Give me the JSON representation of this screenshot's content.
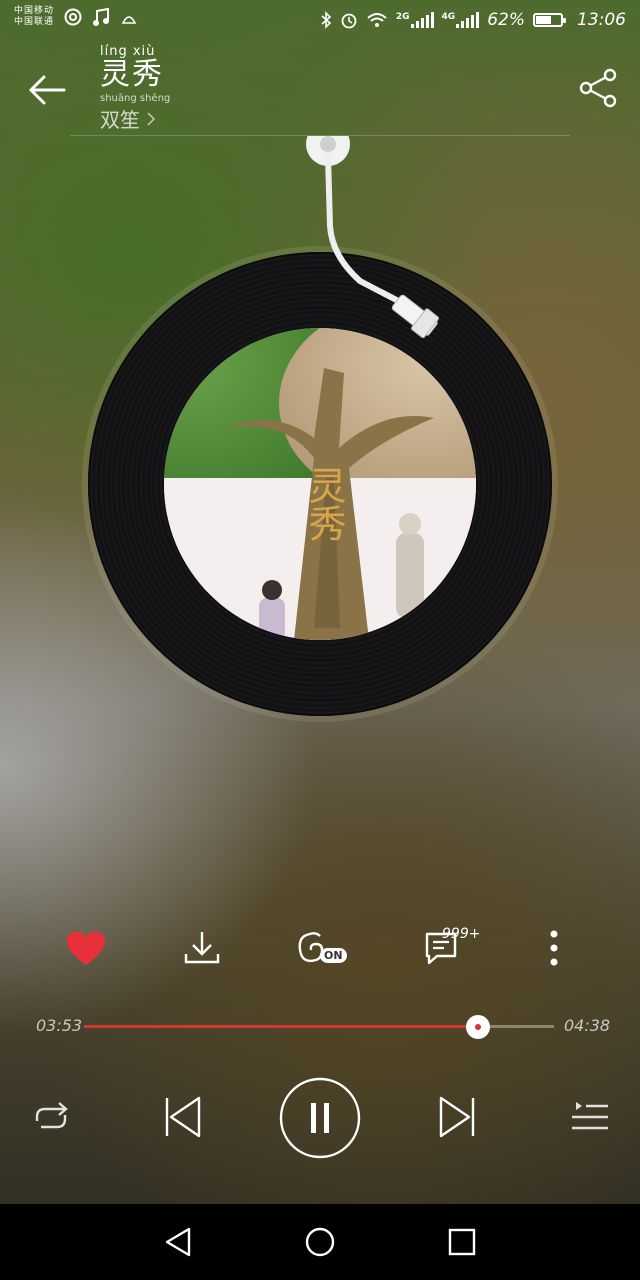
{
  "status_bar": {
    "carrier_1": "中国移动",
    "carrier_2": "中国联通",
    "network_1": "2G",
    "network_2": "4G",
    "battery_percent": "62%",
    "battery_level": 0.62,
    "time": "13:06",
    "icons": [
      "netease-icon",
      "music-note-icon",
      "app-icon",
      "bluetooth-icon",
      "alarm-icon",
      "wifi-icon",
      "signal-icon",
      "signal-icon",
      "battery-icon"
    ]
  },
  "header": {
    "title_pinyin": "líng  xiù",
    "title": "灵秀",
    "artist_pinyin": "shuāng shēng",
    "artist": "双笙",
    "back_icon": "arrow-left-icon",
    "share_icon": "share-icon"
  },
  "cover": {
    "overlay_text": "灵秀"
  },
  "actions": {
    "like_icon": "heart-icon",
    "like_color": "#e8303a",
    "download_icon": "download-icon",
    "effect_badge": "ON",
    "comment_count": "999+",
    "more_icon": "more-vertical-icon"
  },
  "progress": {
    "current": "03:53",
    "total": "04:38",
    "fraction": 0.838,
    "accent": "#d0392e"
  },
  "controls": {
    "repeat_icon": "repeat-icon",
    "prev_icon": "skip-previous-icon",
    "play_state_icon": "pause-icon",
    "next_icon": "skip-next-icon",
    "playlist_icon": "playlist-icon"
  },
  "nav": {
    "back_icon": "nav-back-icon",
    "home_icon": "nav-home-icon",
    "recents_icon": "nav-recents-icon"
  }
}
